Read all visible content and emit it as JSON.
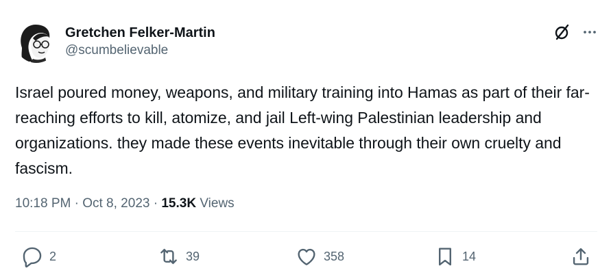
{
  "author": {
    "display_name": "Gretchen Felker-Martin",
    "handle": "@scumbelievable",
    "avatar_icon": "avatar-illustration-icon"
  },
  "tweet": {
    "text": "Israel poured money, weapons, and military training into Hamas as part of their far-reaching efforts to kill, atomize, and jail Left-wing Palestinian leadership and organizations. they made these events inevitable through their own cruelty and fascism.",
    "time": "10:18 PM",
    "date": "Oct 8, 2023",
    "views_count": "15.3K",
    "views_label": "Views",
    "separator": "·"
  },
  "engagement": {
    "replies": "2",
    "reposts": "39",
    "likes": "358",
    "bookmarks": "14"
  },
  "colors": {
    "text_primary": "#0f1419",
    "text_secondary": "#536471",
    "divider": "#eff3f4"
  }
}
